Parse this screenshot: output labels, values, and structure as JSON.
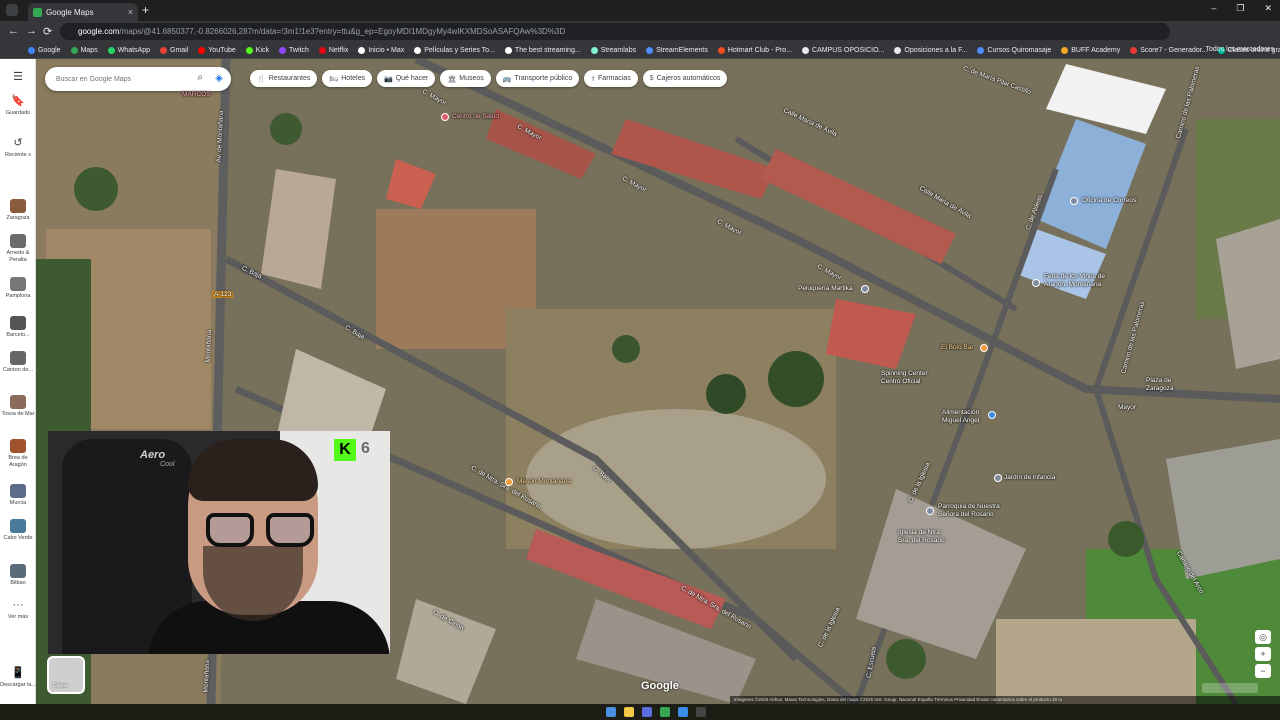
{
  "browser": {
    "tab_title": "Google Maps",
    "tab_close": "×",
    "new_tab": "+",
    "window_controls": [
      "–",
      "❐",
      "✕"
    ],
    "nav": {
      "back": "←",
      "forward": "→",
      "reload": "⟳"
    },
    "url_host": "google.com",
    "url_rest": "/maps/@41.6850377,-0.8266026,287m/data=!3m1!1e3?entry=ttu&g_ep=EgoyMDI1MDgyMy4wIKXMDSoASAFQAw%3D%3D",
    "bookmarks": [
      {
        "label": "Google",
        "color": "#4285f4"
      },
      {
        "label": "Maps",
        "color": "#34a853"
      },
      {
        "label": "WhatsApp",
        "color": "#25d366"
      },
      {
        "label": "Gmail",
        "color": "#ea4335"
      },
      {
        "label": "YouTube",
        "color": "#ff0000"
      },
      {
        "label": "Kick",
        "color": "#53fc18"
      },
      {
        "label": "Twitch",
        "color": "#9146ff"
      },
      {
        "label": "Netflix",
        "color": "#e50914"
      },
      {
        "label": "Inicio • Max",
        "color": "#ffffff"
      },
      {
        "label": "Películas y Series To...",
        "color": "#ffffff"
      },
      {
        "label": "The best streaming...",
        "color": "#ffffff"
      },
      {
        "label": "Streamlabs",
        "color": "#80f5d2"
      },
      {
        "label": "StreamElements",
        "color": "#4f8bff"
      },
      {
        "label": "Hotmart Club - Pro...",
        "color": "#f04e23"
      },
      {
        "label": "CAMPUS OPOSICIO...",
        "color": "#e8eaed"
      },
      {
        "label": "Oposiciones a la F...",
        "color": "#e8eaed"
      },
      {
        "label": "Cursos Quiromasaje",
        "color": "#4f8bff"
      },
      {
        "label": "BUFF Academy",
        "color": "#f5a623"
      },
      {
        "label": "Score7 - Generador...",
        "color": "#e53935"
      },
      {
        "label": "Clases online grabada",
        "color": "#00bfa5"
      }
    ],
    "all_bookmarks": "Todos los marcadores"
  },
  "rail": {
    "menu_icon": "☰",
    "items": [
      {
        "label": "Guardado",
        "icon": "bookmark-icon",
        "glyph": "🔖"
      },
      {
        "label": "Reciente s",
        "icon": "history-icon",
        "glyph": "↺"
      },
      {
        "label": "Zaragoza",
        "icon": "place-thumbnail",
        "color": "#8a5b3c"
      },
      {
        "label": "Arnedo & Peralta",
        "icon": "place-thumbnail",
        "color": "#6b6b6b"
      },
      {
        "label": "Pamplona",
        "icon": "place-thumbnail",
        "color": "#777"
      },
      {
        "label": "Barcelo...",
        "icon": "place-thumbnail",
        "color": "#555"
      },
      {
        "label": "Canton de...",
        "icon": "place-thumbnail",
        "color": "#666"
      },
      {
        "label": "Tossa de Mar",
        "icon": "place-thumbnail",
        "color": "#8a6a5a"
      },
      {
        "label": "Brea de Aragón",
        "icon": "place-thumbnail",
        "color": "#a0522d"
      },
      {
        "label": "Murcia",
        "icon": "place-thumbnail",
        "color": "#5b6b8a"
      },
      {
        "label": "Cabo Verde",
        "icon": "place-thumbnail",
        "color": "#4a7a9a"
      },
      {
        "label": "Bilbao",
        "icon": "place-thumbnail",
        "color": "#5a6a7a"
      },
      {
        "label": "Ver más",
        "icon": "more-icon",
        "glyph": "···"
      }
    ],
    "download_label": "Descargar la...",
    "download_glyph": "📱"
  },
  "map": {
    "search_placeholder": "Buscar en Google Maps",
    "search_glyph": "⌕",
    "directions_glyph": "◈",
    "chips": [
      {
        "label": "Restaurantes",
        "glyph": "🍴"
      },
      {
        "label": "Hoteles",
        "glyph": "🛏"
      },
      {
        "label": "Qué hacer",
        "glyph": "📷"
      },
      {
        "label": "Museos",
        "glyph": "🏛"
      },
      {
        "label": "Transporte público",
        "glyph": "🚌"
      },
      {
        "label": "Farmacias",
        "glyph": "⚕"
      },
      {
        "label": "Cajeros automáticos",
        "glyph": "$"
      }
    ],
    "street_labels": [
      "Av. de Montañana",
      "C. Mayor",
      "C. Mayor",
      "C. Mayor",
      "C. Mayor",
      "C. Mayor",
      "Mayor",
      "Calle María de Ávila",
      "Calle María de Ávila",
      "C. de María Pilar Castillo",
      "C. de Ntra. Sra. del Rosario",
      "C. de Ntra. Sra. del Rosario",
      "C. Baja",
      "C. Baja",
      "C. de la Iglesia",
      "C. de la Iglesia",
      "Camino de las Palomeras",
      "Camino de las Palomeras",
      "Camino del Arco",
      "C. de Aldeas",
      "C. Escuela",
      "C. Baja",
      "A-123",
      "Montañana",
      "C. de Cirión",
      "Montañana"
    ],
    "poi_labels": [
      "Centro de Salud",
      "Peluquería Martika",
      "Oficina de Correos",
      "Feria de los Vinos de Aragón, Montañana",
      "Spinning Center Centro Oficial",
      "El Bolo Bar",
      "Alimentación Miguel Angel",
      "Jardín de infancia",
      "Parroquia de Nuestra Señora del Rosario",
      "Mesón Montañana",
      "Plaza de Zaragoza",
      "Iglesia de Ntra. Sra. del Rosario",
      "MARCOS"
    ],
    "layers_label": "Capas",
    "google_logo": "Google",
    "zoom_in": "+",
    "zoom_out": "−",
    "locate_glyph": "◎",
    "attribution": "Imágenes ©2025 Airbus, Maxar Technologies, Datos del mapa ©2025 Inst. Geogr. Nacional   España   Términos   Privacidad   Enviar comentarios sobre el producto   20 m"
  },
  "webcam": {
    "chair_brand": "Aero",
    "chair_brand_sub": "Cool",
    "kick_icon": "K",
    "viewer_count": "6"
  }
}
